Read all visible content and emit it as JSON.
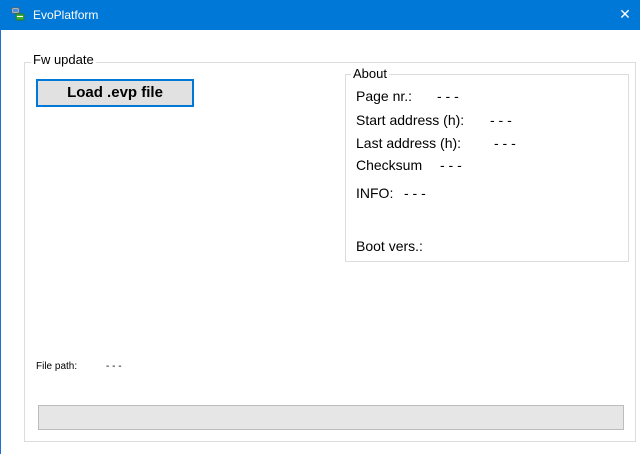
{
  "window": {
    "title": "EvoPlatform",
    "icon": "app-icon",
    "close_glyph": "✕",
    "accent_color": "#0078d7"
  },
  "fw_update": {
    "group_title": "Fw update",
    "load_button_label": "Load .evp file",
    "file_path_label": "File path:",
    "file_path_value": "- - -",
    "progress_percent": 0
  },
  "about": {
    "group_title": "About",
    "page_nr_label": "Page nr.:",
    "page_nr_value": "- - -",
    "start_address_label": "Start address (h):",
    "start_address_value": "- - -",
    "last_address_label": "Last address (h):",
    "last_address_value": "- - -",
    "checksum_label": "Checksum",
    "checksum_value": "- - -",
    "info_label": "INFO:",
    "info_value": "- - -",
    "boot_vers_label": "Boot vers.:"
  }
}
